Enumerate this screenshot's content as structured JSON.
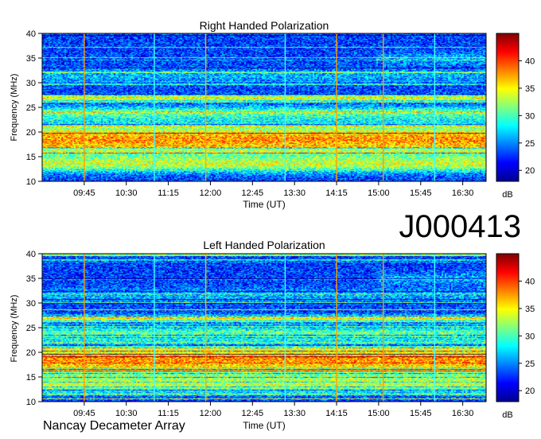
{
  "figure": {
    "observation_id": "J000413",
    "footer": "Nancay Decameter Array"
  },
  "chart_data": [
    {
      "type": "heatmap",
      "title": "Right Handed Polarization",
      "xlabel": "Time (UT)",
      "ylabel": "Frequency (MHz)",
      "colorbar_label": "dB",
      "x_range": [
        "09:00",
        "16:55"
      ],
      "x_ticks": [
        "09:45",
        "10:30",
        "11:15",
        "12:00",
        "12:45",
        "13:30",
        "14:15",
        "15:00",
        "15:45",
        "16:30"
      ],
      "ylim": [
        10,
        40
      ],
      "y_ticks": [
        10,
        15,
        20,
        25,
        30,
        35,
        40
      ],
      "color_range": [
        18,
        45
      ],
      "colorbar_ticks": [
        20,
        25,
        30,
        35,
        40
      ],
      "colormap": "jet",
      "vertical_markers": [
        {
          "time": "09:45",
          "color": "#ff9a00"
        },
        {
          "time": "11:00",
          "color": "#40ffff"
        },
        {
          "time": "11:55",
          "color": "#ffb000"
        },
        {
          "time": "13:20",
          "color": "#40ffff"
        },
        {
          "time": "14:15",
          "color": "#ffa000"
        },
        {
          "time": "15:05",
          "color": "#ff9a00"
        },
        {
          "time": "16:00",
          "color": "#40ffff"
        }
      ]
    },
    {
      "type": "heatmap",
      "title": "Left Handed Polarization",
      "xlabel": "Time (UT)",
      "ylabel": "Frequency (MHz)",
      "colorbar_label": "dB",
      "x_range": [
        "09:00",
        "16:55"
      ],
      "x_ticks": [
        "09:45",
        "10:30",
        "11:15",
        "12:00",
        "12:45",
        "13:30",
        "14:15",
        "15:00",
        "15:45",
        "16:30"
      ],
      "ylim": [
        10,
        40
      ],
      "y_ticks": [
        10,
        15,
        20,
        25,
        30,
        35,
        40
      ],
      "color_range": [
        18,
        45
      ],
      "colorbar_ticks": [
        20,
        25,
        30,
        35,
        40
      ],
      "colormap": "jet",
      "vertical_markers": [
        {
          "time": "09:45",
          "color": "#ff9a00"
        },
        {
          "time": "11:00",
          "color": "#40ffff"
        },
        {
          "time": "11:55",
          "color": "#ffb000"
        },
        {
          "time": "13:20",
          "color": "#40ffff"
        },
        {
          "time": "14:15",
          "color": "#ffa000"
        },
        {
          "time": "15:05",
          "color": "#ff9a00"
        },
        {
          "time": "16:00",
          "color": "#40ffff"
        }
      ]
    }
  ]
}
